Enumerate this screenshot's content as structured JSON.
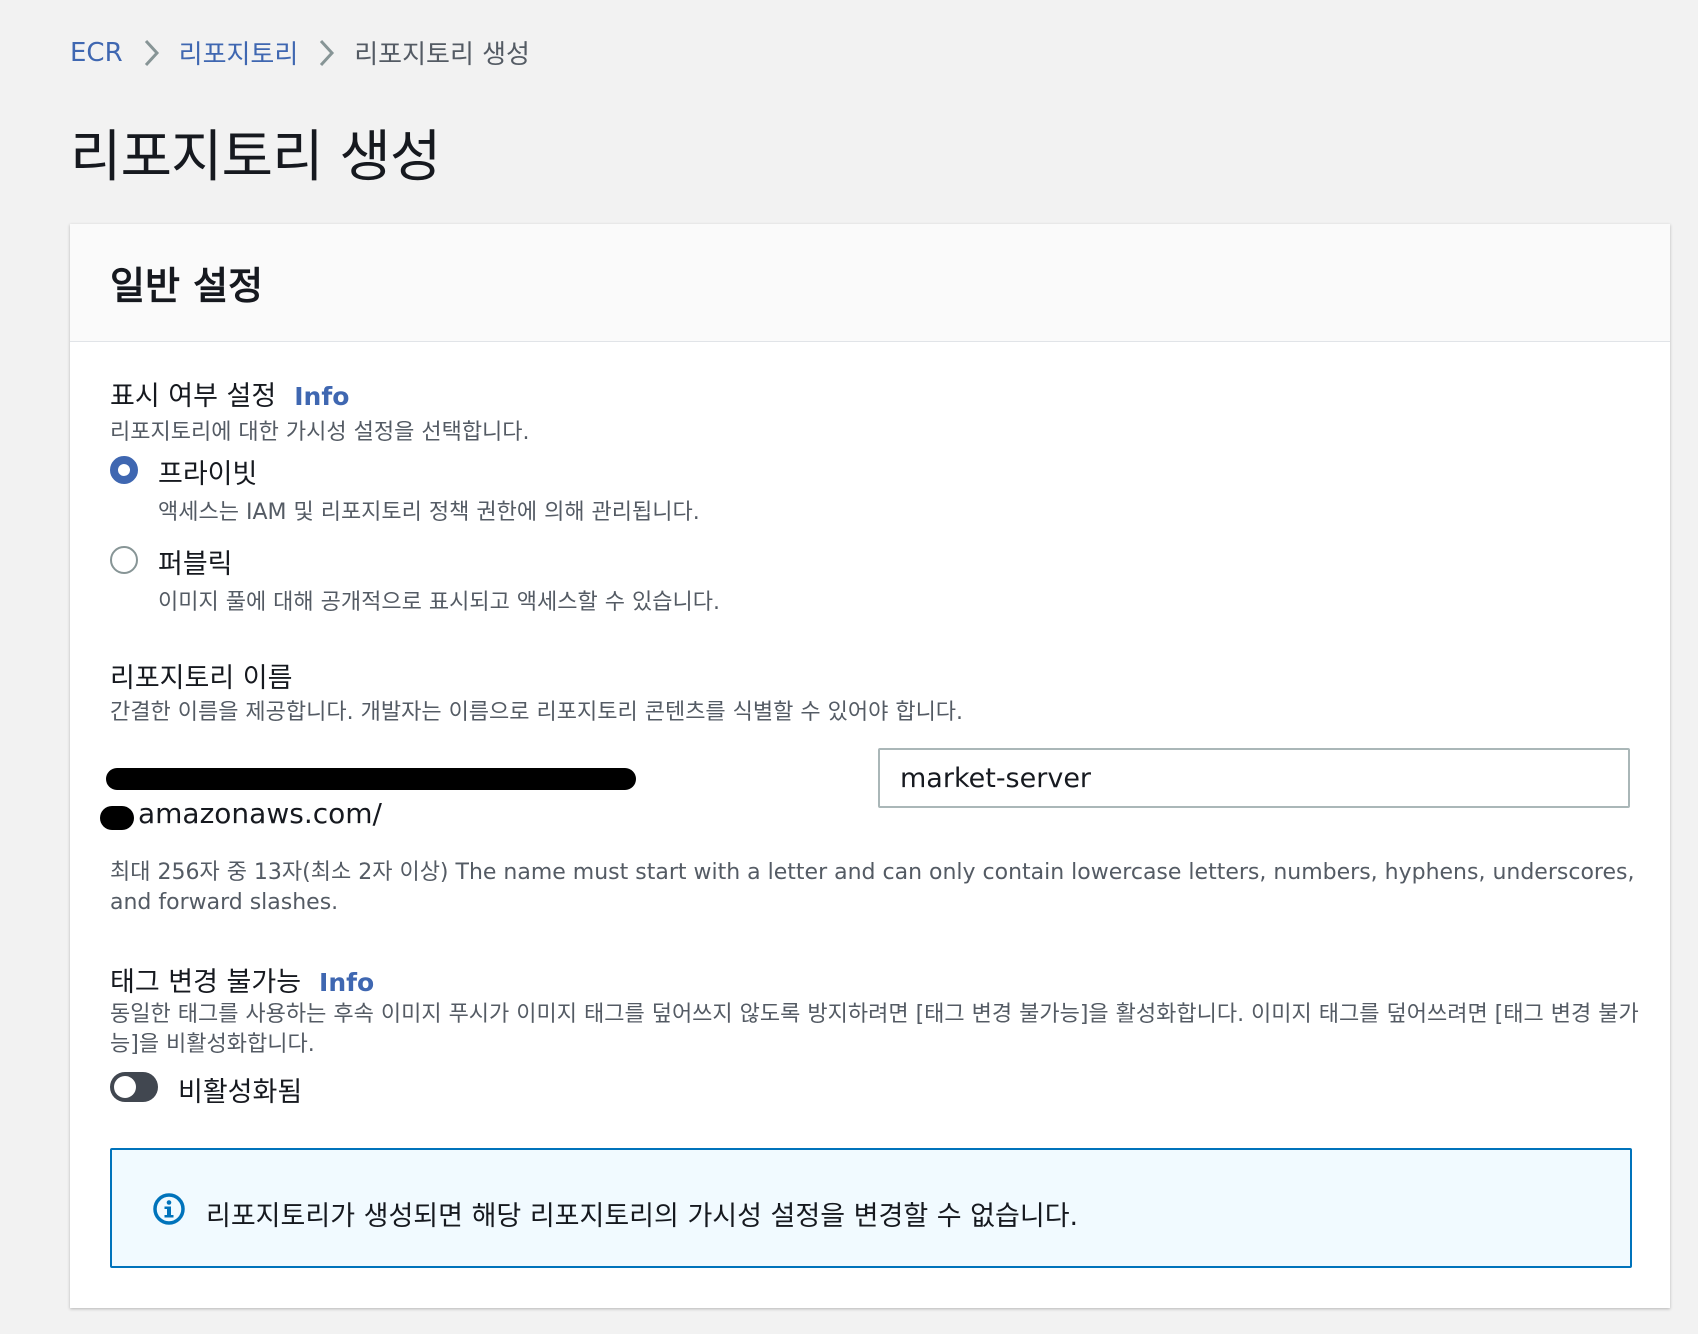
{
  "breadcrumb": {
    "items": [
      "ECR",
      "리포지토리"
    ],
    "current": "리포지토리 생성"
  },
  "page_title": "리포지토리 생성",
  "panel": {
    "title": "일반 설정",
    "visibility": {
      "label": "표시 여부 설정",
      "info": "Info",
      "description": "리포지토리에 대한 가시성 설정을 선택합니다.",
      "options": [
        {
          "label": "프라이빗",
          "description": "액세스는 IAM 및 리포지토리 정책 권한에 의해 관리됩니다.",
          "selected": true
        },
        {
          "label": "퍼블릭",
          "description": "이미지 풀에 대해 공개적으로 표시되고 액세스할 수 있습니다.",
          "selected": false
        }
      ]
    },
    "repo_name": {
      "label": "리포지토리 이름",
      "description": "간결한 이름을 제공합니다. 개발자는 이름으로 리포지토리 콘텐츠를 식별할 수 있어야 합니다.",
      "prefix_suffix": "amazonaws.com/",
      "value": "market-server",
      "constraint": "최대 256자 중 13자(최소 2자 이상) The name must start with a letter and can only contain lowercase letters, numbers, hyphens, underscores, and forward slashes."
    },
    "tag_immutability": {
      "label": "태그 변경 불가능",
      "info": "Info",
      "description": "동일한 태그를 사용하는 후속 이미지 푸시가 이미지 태그를 덮어쓰지 않도록 방지하려면 [태그 변경 불가능]을 활성화합니다. 이미지 태그를 덮어쓰려면 [태그 변경 불가능]을 비활성화합니다.",
      "toggle_label": "비활성화됨",
      "enabled": false
    },
    "alert": {
      "icon": "info-icon",
      "text": "리포지토리가 생성되면 해당 리포지토리의 가시성 설정을 변경할 수 없습니다."
    }
  },
  "colors": {
    "link": "#3f67b1",
    "alert_border": "#0073bb",
    "alert_bg": "#f1faff"
  }
}
